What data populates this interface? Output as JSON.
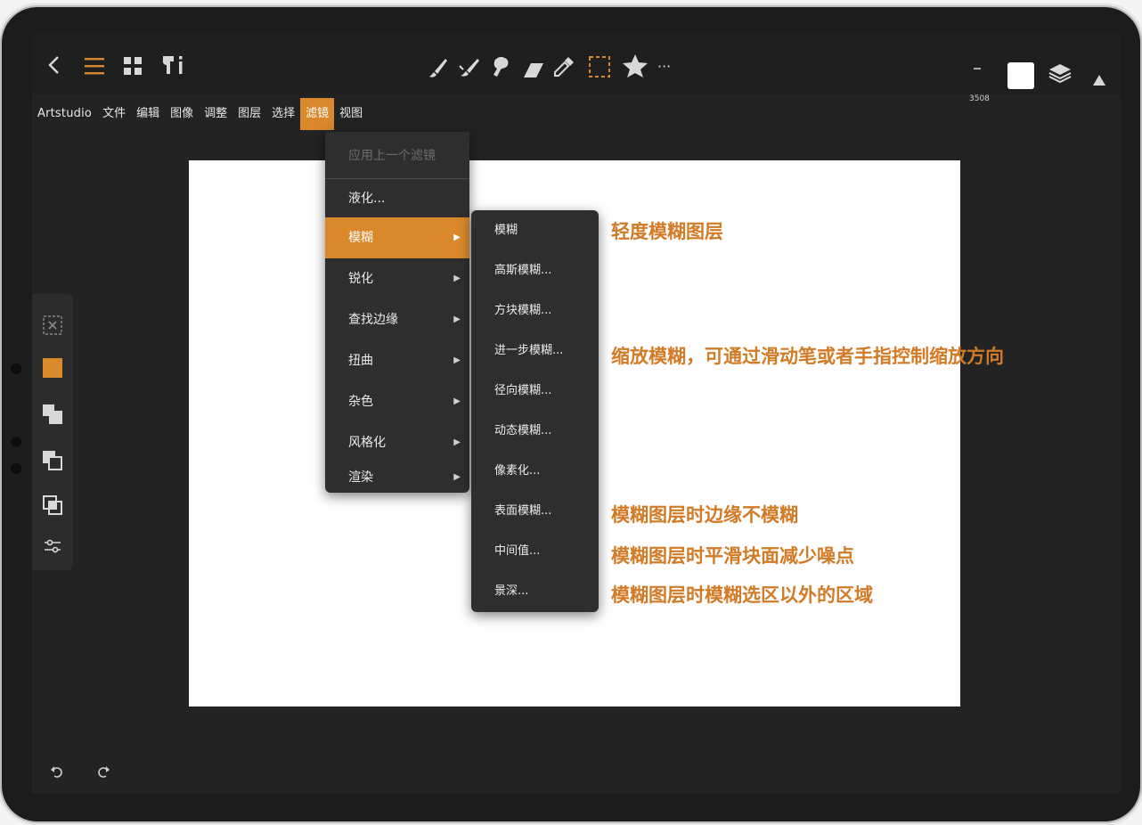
{
  "menubar": {
    "items": [
      {
        "label": "Artstudio"
      },
      {
        "label": "文件"
      },
      {
        "label": "编辑"
      },
      {
        "label": "图像"
      },
      {
        "label": "调整"
      },
      {
        "label": "图层"
      },
      {
        "label": "选择"
      },
      {
        "label": "滤镜"
      },
      {
        "label": "视图"
      }
    ]
  },
  "toolbar": {
    "counter": "3508",
    "more": "···",
    "icons": [
      "back-icon",
      "menu-icon",
      "grid-icon",
      "brush-info-icon",
      "brush-icon",
      "smudge-icon",
      "lasso-icon",
      "eraser-icon",
      "eyedropper-icon",
      "selection-icon",
      "star-icon",
      "more-icon",
      "color-swatch",
      "layers-icon",
      "collapse-icon"
    ]
  },
  "filter_menu": {
    "items": [
      {
        "label": "应用上一个滤镜",
        "disabled": true
      },
      {
        "label": "液化..."
      },
      {
        "label": "模糊",
        "submenu": true,
        "active": true
      },
      {
        "label": "锐化",
        "submenu": true
      },
      {
        "label": "查找边缘",
        "submenu": true
      },
      {
        "label": "扭曲",
        "submenu": true
      },
      {
        "label": "杂色",
        "submenu": true
      },
      {
        "label": "风格化",
        "submenu": true
      },
      {
        "label": "渲染",
        "submenu": true
      }
    ],
    "arrow": "▶"
  },
  "blur_submenu": {
    "items": [
      {
        "label": "模糊"
      },
      {
        "label": "高斯模糊..."
      },
      {
        "label": "方块模糊..."
      },
      {
        "label": "进一步模糊..."
      },
      {
        "label": "径向模糊..."
      },
      {
        "label": "动态模糊..."
      },
      {
        "label": "像素化..."
      },
      {
        "label": "表面模糊..."
      },
      {
        "label": "中间值..."
      },
      {
        "label": "景深..."
      }
    ]
  },
  "annotations": [
    {
      "text": "轻度模糊图层"
    },
    {
      "text": "缩放模糊，可通过滑动笔或者手指控制缩放方向"
    },
    {
      "text": "模糊图层时边缘不模糊"
    },
    {
      "text": "模糊图层时平滑块面减少噪点"
    },
    {
      "text": "模糊图层时模糊选区以外的区域"
    }
  ],
  "colors": {
    "accent": "#d9892b",
    "annotation": "#d27a25",
    "background": "#232323",
    "menu": "#2e2e2e"
  }
}
